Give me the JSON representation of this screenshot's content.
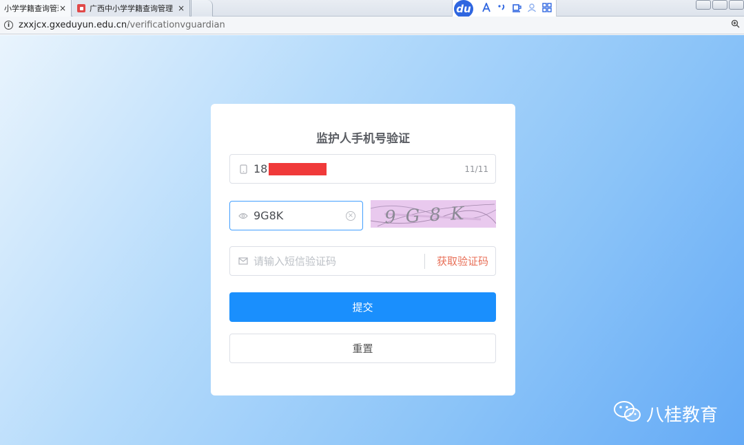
{
  "browser": {
    "tabs": [
      {
        "title": "小学学籍查询管理"
      },
      {
        "title": "广西中小学学籍查询管理"
      }
    ],
    "close_glyph": "×",
    "url_host": "zxxjcx.gxeduyun.edu.cn",
    "url_path": "/verificationvguardian",
    "extension_logo": "du"
  },
  "form": {
    "title": "监护人手机号验证",
    "phone_value": "18",
    "phone_counter": "11/11",
    "captcha_value": "9G8K",
    "captcha_image_text": "9G8K",
    "sms_placeholder": "请输入短信验证码",
    "get_code_label": "获取验证码",
    "submit_label": "提交",
    "reset_label": "重置"
  },
  "watermark": {
    "text": "八桂教育"
  },
  "colors": {
    "primary": "#1a8ffd",
    "focus_border": "#409eff",
    "sms_link": "#e86f57",
    "redaction": "#f03a3a"
  },
  "icons": [
    "info-icon",
    "phone-icon",
    "eye-icon",
    "clear-icon",
    "mail-icon",
    "wechat-icon",
    "zoom-icon"
  ]
}
